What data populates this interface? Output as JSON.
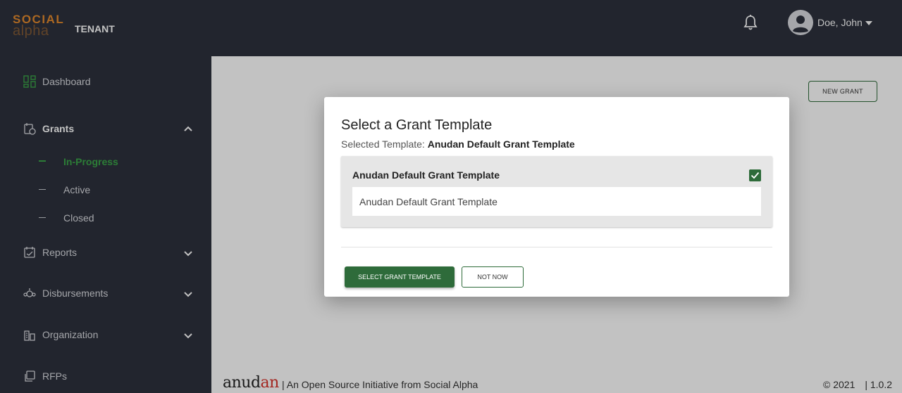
{
  "header": {
    "logo_top": "SOCIAL",
    "logo_bottom": "alpha",
    "tenant": "TENANT",
    "user_name": "Doe, John"
  },
  "sidebar": {
    "dashboard": "Dashboard",
    "grants": "Grants",
    "grants_sub": [
      "In-Progress",
      "Active",
      "Closed"
    ],
    "reports": "Reports",
    "disbursements": "Disbursements",
    "organization": "Organization",
    "rfps": "RFPs"
  },
  "main": {
    "new_grant_button": "NEW GRANT"
  },
  "dialog": {
    "title": "Select a Grant Template",
    "selected_label": "Selected Template:",
    "selected_value": "Anudan Default Grant Template",
    "template_name": "Anudan Default Grant Template",
    "template_description": "Anudan Default Grant Template",
    "select_button": "SELECT GRANT TEMPLATE",
    "not_now_button": "NOT NOW"
  },
  "footer": {
    "logo_prefix": "anud",
    "logo_suffix": "an",
    "tagline": "| An Open Source Initiative from Social Alpha",
    "copyright": "© 2021",
    "version": "| 1.0.2"
  },
  "colors": {
    "topbar": "#2d313d",
    "accent_green": "#2e6b3a",
    "active_green": "#3aa548",
    "logo_orange": "#e3892d"
  }
}
